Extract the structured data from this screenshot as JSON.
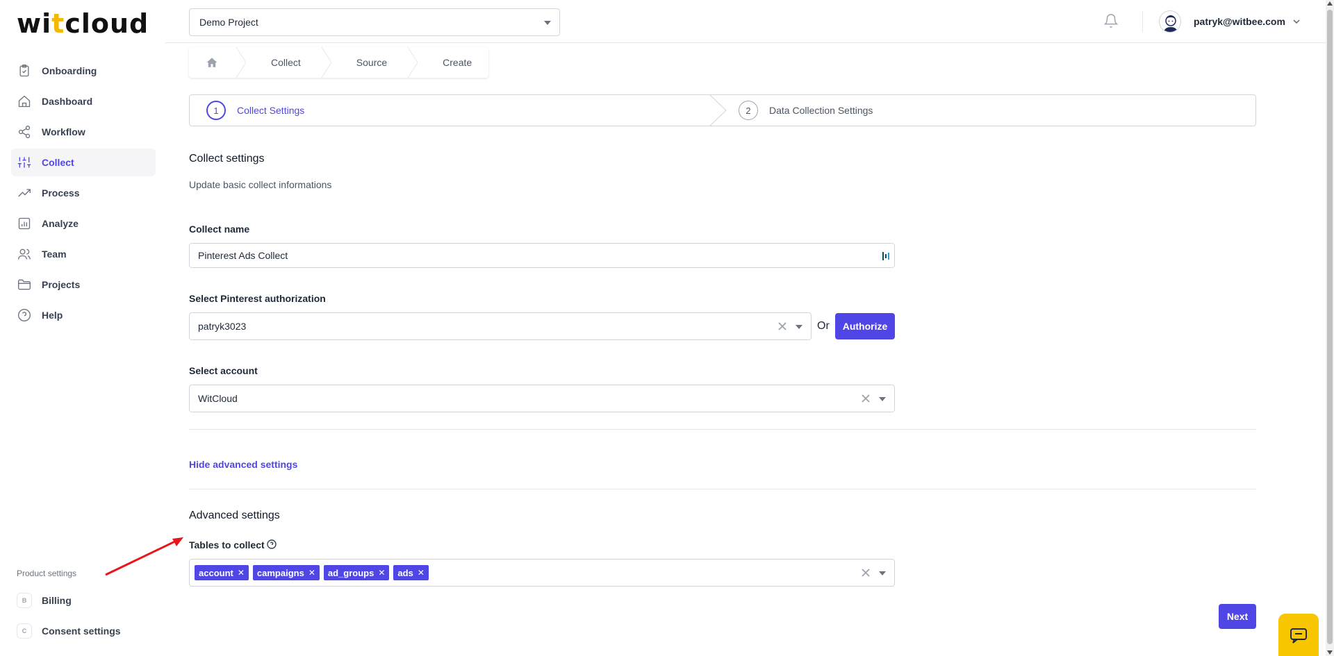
{
  "app": {
    "logo_prefix": "wi",
    "logo_accent": "t",
    "logo_suffix": "cloud"
  },
  "sidebar": {
    "items": [
      {
        "label": "Onboarding",
        "icon": "clipboard-icon",
        "active": false
      },
      {
        "label": "Dashboard",
        "icon": "home-icon",
        "active": false
      },
      {
        "label": "Workflow",
        "icon": "share-icon",
        "active": false
      },
      {
        "label": "Collect",
        "icon": "sliders-icon",
        "active": true
      },
      {
        "label": "Process",
        "icon": "trending-up-icon",
        "active": false
      },
      {
        "label": "Analyze",
        "icon": "bar-chart-icon",
        "active": false
      },
      {
        "label": "Team",
        "icon": "users-icon",
        "active": false
      },
      {
        "label": "Projects",
        "icon": "folder-icon",
        "active": false
      },
      {
        "label": "Help",
        "icon": "help-circle-icon",
        "active": false
      }
    ],
    "product_settings_label": "Product settings",
    "bottom_items": [
      {
        "letter": "B",
        "label": "Billing"
      },
      {
        "letter": "C",
        "label": "Consent settings"
      }
    ]
  },
  "topbar": {
    "project": "Demo Project",
    "user_email": "patryk@witbee.com"
  },
  "breadcrumb": [
    "Collect",
    "Source",
    "Create"
  ],
  "stepper": {
    "steps": [
      {
        "num": "1",
        "label": "Collect Settings"
      },
      {
        "num": "2",
        "label": "Data Collection Settings"
      }
    ]
  },
  "main": {
    "title": "Collect settings",
    "subtitle": "Update basic collect informations",
    "collect_name_label": "Collect name",
    "collect_name_value": "Pinterest Ads Collect",
    "auth_label": "Select Pinterest authorization",
    "auth_value": "patryk3023",
    "or_text": "Or",
    "authorize_button": "Authorize",
    "account_label": "Select account",
    "account_value": "WitCloud",
    "hide_advanced_link": "Hide advanced settings",
    "advanced_title": "Advanced settings",
    "tables_label": "Tables to collect",
    "tables": [
      "account",
      "campaigns",
      "ad_groups",
      "ads"
    ],
    "next_button": "Next"
  },
  "colors": {
    "accent": "#4f46e5",
    "logo_accent": "#f5b800",
    "chat_button": "#f7c600",
    "annotation_arrow": "#e8161b"
  }
}
